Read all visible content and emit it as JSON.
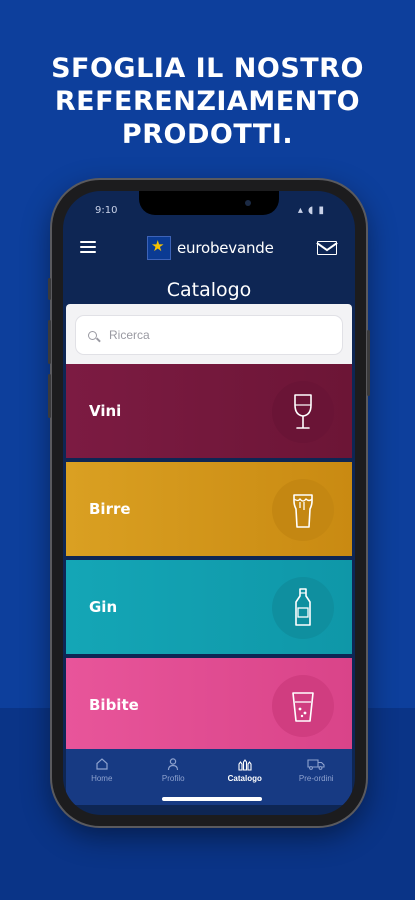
{
  "headline": {
    "line1": "SFOGLIA IL NOSTRO",
    "line2": "REFERENZIAMENTO",
    "line3": "PRODOTTI."
  },
  "status_bar": {
    "time": "9:10",
    "icons": "▴ ◖ ▮"
  },
  "app": {
    "brand": "eurobevande",
    "page_title": "Catalogo",
    "search_placeholder": "Ricerca"
  },
  "categories": [
    {
      "label": "Vini",
      "icon": "wine-glass-icon",
      "color": "#7c1b42"
    },
    {
      "label": "Birre",
      "icon": "beer-glass-icon",
      "color": "#d4961c"
    },
    {
      "label": "Gin",
      "icon": "gin-bottle-icon",
      "color": "#13a2b2"
    },
    {
      "label": "Bibite",
      "icon": "soft-drink-glass-icon",
      "color": "#e24f95"
    }
  ],
  "tabs": [
    {
      "label": "Home",
      "icon": "home-icon"
    },
    {
      "label": "Profilo",
      "icon": "profile-icon"
    },
    {
      "label": "Catalogo",
      "icon": "catalog-icon",
      "active": true
    },
    {
      "label": "Pre-ordini",
      "icon": "truck-icon"
    }
  ],
  "colors": {
    "background": "#0d3f9c",
    "screen": "#0e2654",
    "tabbar": "#173a83",
    "accent_star": "#f7c200"
  }
}
